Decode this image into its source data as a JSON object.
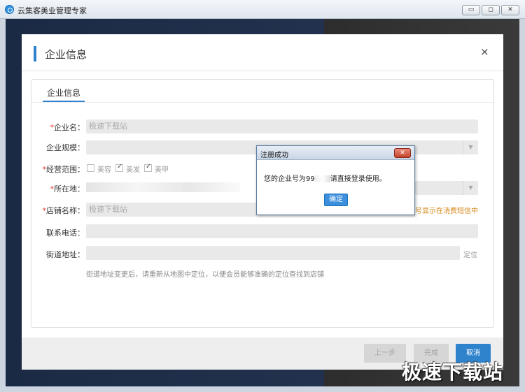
{
  "window": {
    "title": "云集客美业管理专家",
    "min": "▭",
    "max": "◻",
    "close": "✕"
  },
  "dialog": {
    "title": "企业信息",
    "close": "×",
    "tab": "企业信息",
    "fields": {
      "company_name_label": "企业名：",
      "company_name_value": "极速下载站",
      "scale_label": "企业规模：",
      "scope_label": "经营范围：",
      "scope_options": [
        "美容",
        "美发",
        "美甲"
      ],
      "location_label": "所在地：",
      "store_name_label": "店铺名称：",
      "store_name_value": "极速下载站",
      "store_hint": "号显示在消费短信中",
      "phone_label": "联系电话：",
      "street_label": "街道地址：",
      "locate_link": "定位",
      "street_help": "街道地址变更后，请重新从地图中定位，以便会员能够准确的定位查找到店铺"
    },
    "footer": {
      "prev": "上一步",
      "finish": "完成",
      "cancel": "取消"
    }
  },
  "popup": {
    "title": "注册成功",
    "close": "✕",
    "message_prefix": "您的企业号为99",
    "message_suffix": "请直接登录使用。",
    "ok": "确定"
  },
  "watermark": "极速下载站"
}
